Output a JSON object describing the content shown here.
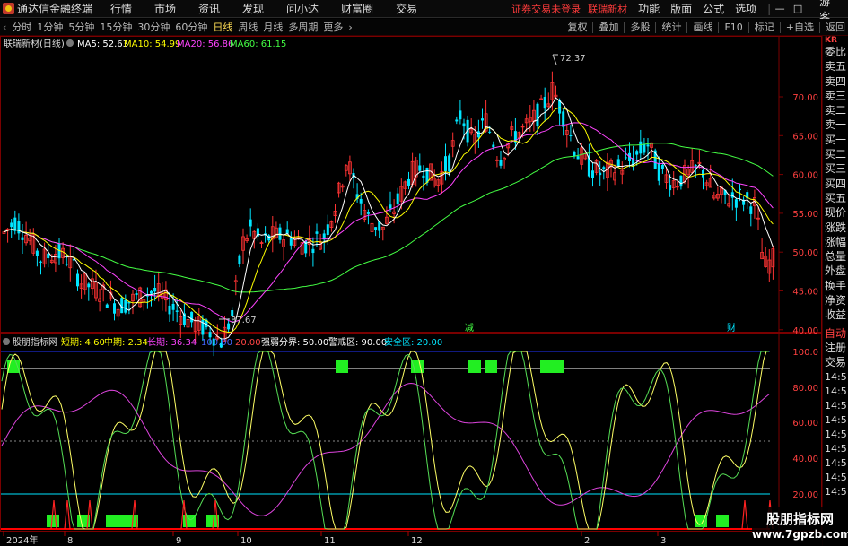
{
  "menubar": {
    "app_title": "通达信金融终端",
    "items": [
      "行情",
      "市场",
      "资讯",
      "发现",
      "问小达",
      "财富圈",
      "交易"
    ],
    "notice": "证券交易未登录",
    "stock_name": "联瑞新材",
    "right_items": [
      "功能",
      "版面",
      "公式",
      "选项"
    ],
    "guest": "游客"
  },
  "toolbar": {
    "periods": [
      "分时",
      "1分钟",
      "5分钟",
      "15分钟",
      "30分钟",
      "60分钟",
      "日线",
      "周线",
      "月线",
      "多周期",
      "更多"
    ],
    "active_period": "日线",
    "right_items": [
      "复权",
      "叠加",
      "多股",
      "统计",
      "画线",
      "F10",
      "标记",
      "+自选",
      "返回"
    ]
  },
  "main_chart": {
    "title": "联瑞新材(日线)",
    "indicators": [
      {
        "label": "MA5: 52.63",
        "color": "#ffffff"
      },
      {
        "label": "MA10: 54.99",
        "color": "#ffff00"
      },
      {
        "label": "MA20: 56.86",
        "color": "#ff44ff"
      },
      {
        "label": "MA60: 61.15",
        "color": "#44ff44"
      }
    ],
    "y_ticks": [
      "70.00",
      "65.00",
      "60.00",
      "55.00",
      "50.00",
      "45.00",
      "40.00"
    ],
    "high_label": "72.37",
    "low_label": "37.67",
    "marker_1": "减",
    "marker_2": "财"
  },
  "sub_chart": {
    "title": "股朋指标网",
    "short_label": "短期: 4.60",
    "mid_label": "中期: 2.34",
    "long_label": "长期: 36.34",
    "v100_label": "100.00",
    "v20_label": "20.00",
    "strong_label": "强弱分界: 50.00",
    "warn_label": "警戒区: 90.00",
    "safe_label": "安全区: 20.00",
    "y_ticks": [
      "100.0",
      "80.00",
      "60.00",
      "40.00",
      "20.00"
    ]
  },
  "x_axis": {
    "labels": [
      "2024年",
      "8",
      "9",
      "10",
      "11",
      "12",
      "2",
      "3"
    ]
  },
  "side_panel": {
    "kr_label": "KR",
    "items": [
      "委比",
      "卖五",
      "卖四",
      "卖三",
      "卖二",
      "卖一",
      "买一",
      "买二",
      "买三",
      "买四",
      "买五",
      "现价",
      "涨跌",
      "涨幅",
      "总量",
      "外盘",
      "换手",
      "净资",
      "收益"
    ],
    "lower_items": [
      "自动",
      "注册",
      "交易"
    ],
    "times": [
      "14:5",
      "14:5",
      "14:5",
      "14:5",
      "14:5",
      "14:5",
      "14:5",
      "14:5",
      "14:5"
    ]
  },
  "watermark": {
    "title": "股朋指标网",
    "url": "www.7gpzb.com"
  },
  "colors": {
    "up": "#ff3333",
    "down": "#00e5ff",
    "ma5": "#ffffff",
    "ma10": "#ffff00",
    "ma20": "#ff44ff",
    "ma60": "#44ff44"
  }
}
